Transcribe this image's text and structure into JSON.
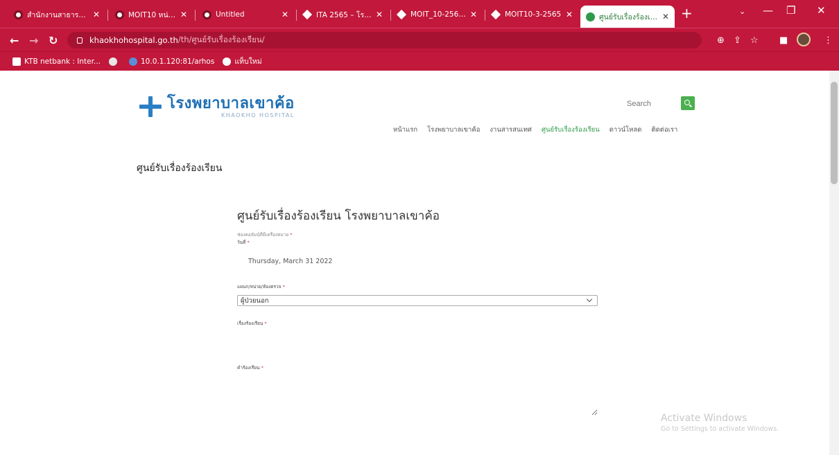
{
  "browser": {
    "tabs": [
      {
        "title": "สำนักงานสาธารณสุ",
        "icon": "chrome-icon"
      },
      {
        "title": "MOIT10 หน่วยงาน",
        "icon": "chrome-icon"
      },
      {
        "title": "Untitled",
        "icon": "chrome-icon"
      },
      {
        "title": "ITA 2565 – โรงพ",
        "icon": "diamond-icon"
      },
      {
        "title": "MOIT_10-2565 -",
        "icon": "diamond-icon"
      },
      {
        "title": "MOIT10-3-2565",
        "icon": "diamond-icon"
      },
      {
        "title": "ศูนย์รับเรื่องร้องเรียน",
        "icon": "site-icon"
      }
    ],
    "new_tab": "+",
    "close": "✕",
    "url_host": "khaokhohospital.go.th",
    "url_path": "/th/ศูนย์รับเรื่องร้องเรียน/",
    "bookmarks": [
      {
        "label": "KTB netbank : Inter..."
      },
      {
        "label": ""
      },
      {
        "label": "10.0.1.120:81/arhos"
      },
      {
        "label": "แท็บใหม่"
      }
    ],
    "colors": {
      "chrome": "#c2183b",
      "omnibox": "#a81232"
    }
  },
  "site": {
    "logo_thai": "โรงพยาบาลเขาค้อ",
    "logo_eng": "KHAOKHO HOSPITAL",
    "search_placeholder": "Search",
    "menu": [
      {
        "label": "หน้าแรก",
        "active": false
      },
      {
        "label": "โรงพยาบาลเขาค้อ",
        "active": false
      },
      {
        "label": "งานสารสนเทศ",
        "active": false
      },
      {
        "label": "ศูนย์รับเรื่องร้องเรียน",
        "active": true
      },
      {
        "label": "ดาวน์โหลด",
        "active": false
      },
      {
        "label": "ติดต่อเรา",
        "active": false
      }
    ],
    "accent_color": "#4caf50"
  },
  "main": {
    "heading": "ศูนย์รับเรื่องร้องเรียน",
    "form": {
      "title": "ศูนย์รับเรื่องร้องเรียน โรงพยาบาลเขาค้อ",
      "required_note": "ช่องคอลัมน์ที่มีเครื่องหมาย",
      "date_label": "วันที่",
      "date_value": "Thursday, March 31 2022",
      "department_label": "แผนก/หน่วย/ห้องตรวจ",
      "department_value": "ผู้ป่วยนอก",
      "topic_label": "เรื่องร้องเรียน",
      "detail_label": "คำร้องเรียน",
      "required_mark": "*"
    }
  },
  "watermark": {
    "line1": "Activate Windows",
    "line2": "Go to Settings to activate Windows."
  }
}
